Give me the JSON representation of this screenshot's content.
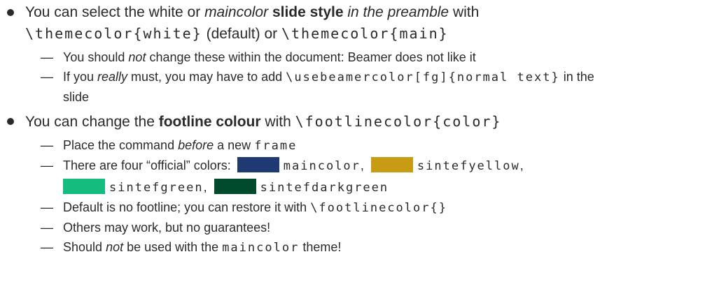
{
  "item1": {
    "p1": "You can select the white or ",
    "em1": "maincolor",
    "p2": " ",
    "strong1": "slide style",
    "p3": " ",
    "em2": "in the preamble",
    "p4": " with",
    "code1": "\\themecolor{white}",
    "p5": " (default) or ",
    "code2": "\\themecolor{main}",
    "sub1": {
      "p1": "You should ",
      "em1": "not",
      "p2": " change these within the document: Beamer does not like it"
    },
    "sub2": {
      "p1": "If you ",
      "em1": "really",
      "p2": " must, you may have to add ",
      "code1": "\\usebeamercolor[fg]{normal text}",
      "p3": " in the",
      "p4": "slide"
    }
  },
  "item2": {
    "p1": "You can change the ",
    "strong1": "footline colour",
    "p2": " with ",
    "code1": "\\footlinecolor{color}",
    "sub1": {
      "p1": "Place the command ",
      "em1": "before",
      "p2": " a new ",
      "code1": "frame"
    },
    "sub2": {
      "p1": "There are four “official” colors: ",
      "colors": [
        {
          "name": "maincolor",
          "sep": ",",
          "hex": "#1f3a73"
        },
        {
          "name": "sintefyellow",
          "sep": ",",
          "hex": "#c89b14"
        },
        {
          "name": "sintefgreen",
          "sep": ",",
          "hex": "#14bd7e"
        },
        {
          "name": "sintefdarkgreen",
          "sep": "",
          "hex": "#004b2d"
        }
      ]
    },
    "sub3": {
      "p1": "Default is no footline; you can restore it with ",
      "code1": "\\footlinecolor{}"
    },
    "sub4": {
      "p1": "Others may work, but no guarantees!"
    },
    "sub5": {
      "p1": "Should ",
      "em1": "not",
      "p2": " be used with the ",
      "code1": "maincolor",
      "p3": " theme!"
    }
  }
}
